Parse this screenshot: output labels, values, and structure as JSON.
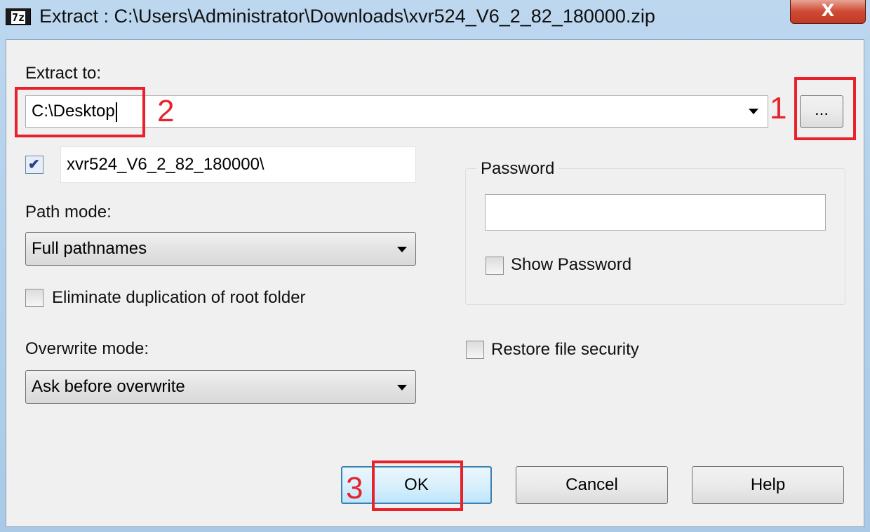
{
  "window": {
    "icon_text": "7z",
    "title": "Extract : C:\\Users\\Administrator\\Downloads\\xvr524_V6_2_82_180000.zip",
    "close_glyph": "X"
  },
  "extract_to": {
    "label": "Extract to:",
    "value": "C:\\Desktop",
    "browse_label": "..."
  },
  "subfolder": {
    "checked": true,
    "value": "xvr524_V6_2_82_180000\\"
  },
  "path_mode": {
    "label": "Path mode:",
    "selected": "Full pathnames"
  },
  "eliminate_duplication": {
    "label": "Eliminate duplication of root folder",
    "checked": false
  },
  "overwrite_mode": {
    "label": "Overwrite mode:",
    "selected": "Ask before overwrite"
  },
  "password": {
    "group_label": "Password",
    "value": "",
    "show_label": "Show Password",
    "show_checked": false
  },
  "restore_security": {
    "label": "Restore file security",
    "checked": false
  },
  "buttons": {
    "ok": "OK",
    "cancel": "Cancel",
    "help": "Help"
  },
  "annotations": {
    "step1": "1",
    "step2": "2",
    "step3": "3",
    "color": "#e8222a"
  },
  "icons": {
    "dropdown": "chevron-down-icon",
    "checkmark": "checkmark-icon",
    "app": "7zip-icon",
    "close": "close-icon"
  }
}
